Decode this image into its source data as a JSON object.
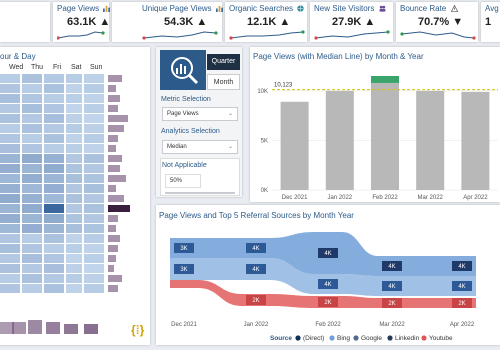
{
  "kpis": [
    {
      "title": "",
      "value": ""
    },
    {
      "title": "Page Views",
      "value": "63.1K",
      "trend": "▲",
      "icon": "bar-chart-icon"
    },
    {
      "title": "Unique Page Views",
      "value": "54.3K",
      "trend": "▲",
      "icon": "bar-chart-icon"
    },
    {
      "title": "Organic Searches",
      "value": "12.1K",
      "trend": "▲",
      "icon": "globe-icon"
    },
    {
      "title": "New Site Visitors",
      "value": "27.9K",
      "trend": "▲",
      "icon": "users-icon"
    },
    {
      "title": "Bounce Rate",
      "value": "70.7%",
      "trend": "▼",
      "icon": "warning-icon"
    },
    {
      "title": "Avg S",
      "value": "1"
    }
  ],
  "heatmap": {
    "title": "our & Day",
    "days": [
      "Wed",
      "Thu",
      "Fri",
      "Sat",
      "Sun"
    ]
  },
  "slicer": {
    "quarter_label": "Quarter",
    "month_label": "Month",
    "metric_selection_label": "Metric Selection",
    "metric_value": "Page Views",
    "analytics_selection_label": "Analytics Selection",
    "analytics_value": "Median",
    "not_applicable_label": "Not Applicable",
    "percent_value": "50%"
  },
  "colors": {
    "accent_blue": "#2c5b8a",
    "bar_gray": "#b8b8b8",
    "median_line": "#d8c400",
    "bar_highlight_green": "#3aa46b",
    "heat_dark": "#2d5a96",
    "heat_light": "#cfe0f3",
    "side_bar_purple": "#6a4a73"
  },
  "chart_data": [
    {
      "type": "bar",
      "title": "Page Views (with Median Line) by Month & Year",
      "categories": [
        "Dec 2021",
        "Jan 2022",
        "Feb 2022",
        "Mar 2022",
        "Apr 2022"
      ],
      "values": [
        8900,
        10000,
        10800,
        10000,
        9900
      ],
      "above_median": [
        0,
        0,
        700,
        0,
        0
      ],
      "median_value": 10123,
      "median_label": "10,123",
      "yticks": [
        0,
        5000,
        10000
      ],
      "ytick_labels": [
        "0K",
        "5K",
        "10K"
      ],
      "ylim": [
        0,
        11500
      ]
    },
    {
      "type": "area",
      "title": "Page Views and Top 5 Referral Sources by Month Year",
      "categories": [
        "Dec 2021",
        "Jan 2022",
        "Feb 2022",
        "Mar 2022",
        "Apr 2022"
      ],
      "series": [
        {
          "name": "(Direct)",
          "color": "#0f2f5c",
          "values": [
            3000,
            4000,
            4000,
            4000,
            4000
          ]
        },
        {
          "name": "Bing",
          "color": "#6f9fd8"
        },
        {
          "name": "Google",
          "color": "#4f6a91"
        },
        {
          "name": "Linkedin",
          "color": "#263a59"
        },
        {
          "name": "Youtube",
          "color": "#e15759"
        }
      ],
      "flow_labels": [
        {
          "month": "Dec 2021",
          "band": 0,
          "label": "3K"
        },
        {
          "month": "Dec 2021",
          "band": 1,
          "label": "3K"
        },
        {
          "month": "Jan 2022",
          "band": 0,
          "label": "4K"
        },
        {
          "month": "Jan 2022",
          "band": 1,
          "label": "4K"
        },
        {
          "month": "Jan 2022",
          "band": 2,
          "label": "2K"
        },
        {
          "month": "Feb 2022",
          "band": 0,
          "label": "4K"
        },
        {
          "month": "Feb 2022",
          "band": 1,
          "label": "4K"
        },
        {
          "month": "Feb 2022",
          "band": 2,
          "label": "2K"
        },
        {
          "month": "Mar 2022",
          "band": 0,
          "label": "4K"
        },
        {
          "month": "Mar 2022",
          "band": 1,
          "label": "4K"
        },
        {
          "month": "Mar 2022",
          "band": 2,
          "label": "2K"
        },
        {
          "month": "Apr 2022",
          "band": 0,
          "label": "4K"
        },
        {
          "month": "Apr 2022",
          "band": 1,
          "label": "4K"
        },
        {
          "month": "Apr 2022",
          "band": 2,
          "label": "2K"
        }
      ],
      "legend_title": "Source"
    }
  ]
}
